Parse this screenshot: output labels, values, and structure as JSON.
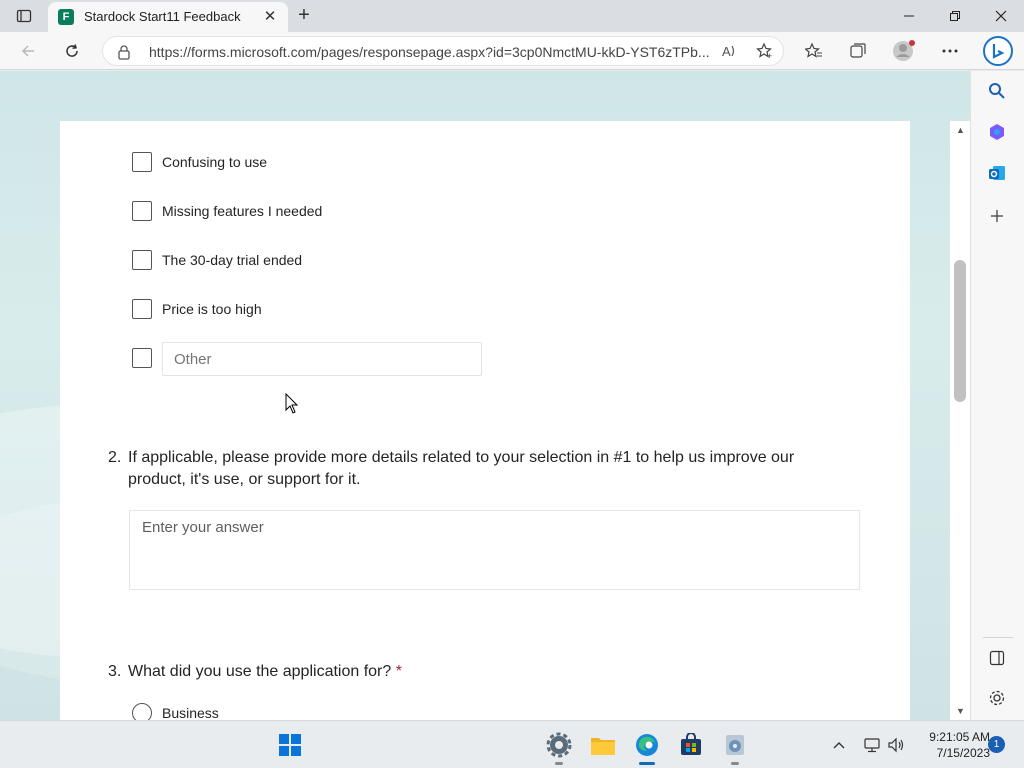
{
  "browser": {
    "tab": {
      "title": "Stardock Start11 Feedback",
      "favicon": "forms-icon"
    },
    "url": "https://forms.microsoft.com/pages/responsepage.aspx?id=3cp0NmctMU-kkD-YST6zTPb...",
    "window_controls": [
      "minimize",
      "restore",
      "close"
    ]
  },
  "form": {
    "options": [
      {
        "label": "Confusing to use"
      },
      {
        "label": "Missing features I needed"
      },
      {
        "label": "The 30-day trial ended"
      },
      {
        "label": "Price is too high"
      }
    ],
    "other_placeholder": "Other",
    "q2": {
      "number": "2.",
      "text": "If applicable, please provide more details related to your selection in #1 to help us improve our product, it's use, or support for it.",
      "answer_placeholder": "Enter your answer"
    },
    "q3": {
      "number": "3.",
      "text": "What did you use the application for?",
      "required_mark": "*",
      "options": [
        {
          "label": "Business"
        }
      ]
    }
  },
  "taskbar": {
    "time": "9:21:05 AM",
    "date": "7/15/2023",
    "notification_count": "1"
  },
  "colors": {
    "accent": "#0f6cbd",
    "required": "#a4262c",
    "content_bg": "#d4e9ea"
  }
}
